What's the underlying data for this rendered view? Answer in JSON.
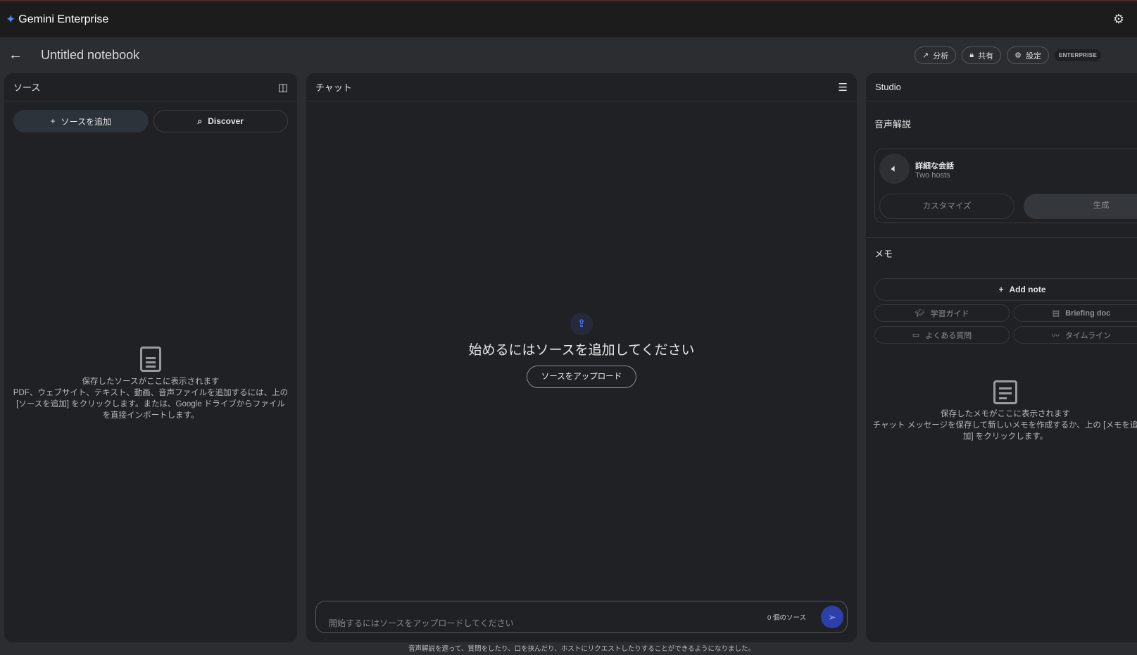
{
  "app": {
    "title": "Gemini Enterprise"
  },
  "header": {
    "notebook_title": "Untitled notebook",
    "actions": [
      {
        "label": "分析",
        "icon": "trending-up-icon"
      },
      {
        "label": "共有",
        "icon": "lock-icon"
      },
      {
        "label": "設定",
        "icon": "gear-icon"
      }
    ],
    "badge": "ENTERPRISE"
  },
  "sources": {
    "title": "ソース",
    "add_label": "ソースを追加",
    "discover_label": "Discover",
    "empty_title": "保存したソースがここに表示されます",
    "empty_body": "PDF、ウェブサイト、テキスト、動画、音声ファイルを追加するには、上の [ソースを追加] をクリックします。または、Google ドライブからファイルを直接インポートします。"
  },
  "chat": {
    "title": "チャット",
    "heading": "始めるにはソースを追加してください",
    "upload_label": "ソースをアップロード",
    "input_placeholder": "開始するにはソースをアップロードしてください",
    "source_count": "0 個のソース",
    "footer": "音声解説を遮って、質問をしたり、口を挟んだり、ホストにリクエストしたりすることができるようになりました。"
  },
  "studio": {
    "title": "Studio",
    "audio": {
      "heading": "音声解説",
      "card_title": "詳細な会話",
      "card_subtitle": "Two hosts",
      "customize_label": "カスタマイズ",
      "generate_label": "生成"
    },
    "notes": {
      "heading": "メモ",
      "add_note_label": "Add note",
      "templates": [
        {
          "label": "学習ガイド",
          "icon": "graduation-cap-icon"
        },
        {
          "label": "Briefing doc",
          "icon": "briefing-doc-icon"
        },
        {
          "label": "よくある質問",
          "icon": "faq-icon"
        },
        {
          "label": "タイムライン",
          "icon": "timeline-icon"
        }
      ],
      "empty_title": "保存したメモがここに表示されます",
      "empty_body": "チャット メッセージを保存して新しいメモを作成するか、上の [メモを追加] をクリックします。"
    }
  },
  "colors": {
    "accent": "#4a8bf5",
    "send": "#2d3fa8",
    "panel": "#1f2125"
  }
}
